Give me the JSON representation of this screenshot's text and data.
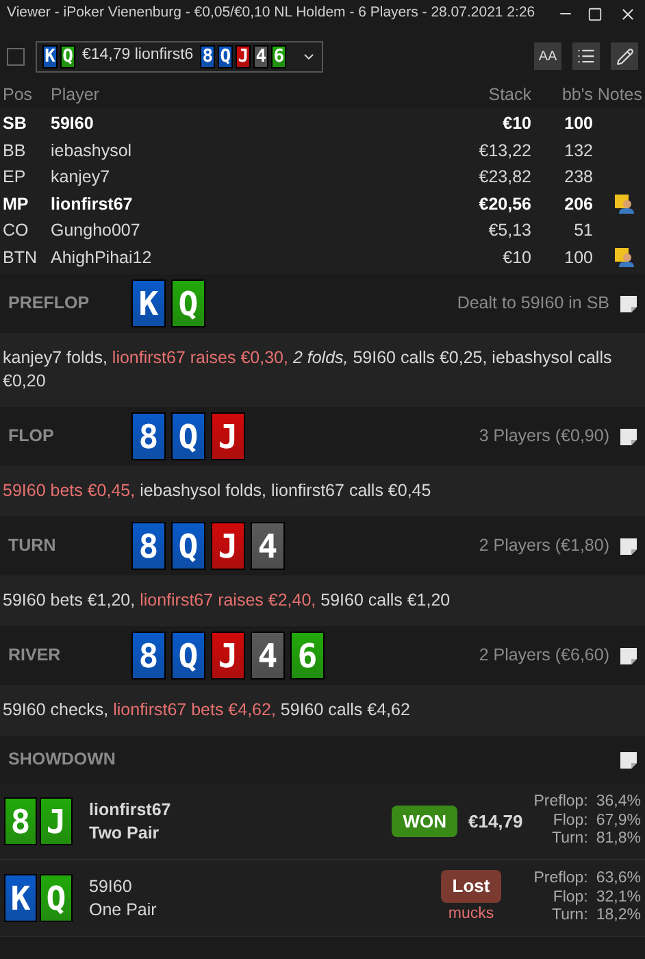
{
  "window": {
    "title": "Viewer - iPoker Vienenburg - €0,05/€0,10 NL Holdem - 6 Players - 28.07.2021 2:26"
  },
  "toolbar": {
    "checked": false,
    "hand_selector": {
      "hero_cards": [
        {
          "rank": "K",
          "color": "#0a5ac8"
        },
        {
          "rank": "Q",
          "color": "#22a80a"
        }
      ],
      "text": "€14,79 lionfirst6",
      "board": [
        {
          "rank": "8",
          "color": "#0a5ac8"
        },
        {
          "rank": "Q",
          "color": "#0a5ac8"
        },
        {
          "rank": "J",
          "color": "#d00a0a"
        },
        {
          "rank": "4",
          "color": "#5a5a5a"
        },
        {
          "rank": "6",
          "color": "#22a80a"
        }
      ]
    },
    "font_button": "AA"
  },
  "table": {
    "columns": [
      "Pos",
      "Player",
      "Stack",
      "bb's",
      "Notes"
    ],
    "rows": [
      {
        "pos": "SB",
        "player": "59I60",
        "stack": "€10",
        "bbs": "100",
        "bold": true,
        "note": false
      },
      {
        "pos": "BB",
        "player": "iebashysol",
        "stack": "€13,22",
        "bbs": "132",
        "bold": false,
        "note": false
      },
      {
        "pos": "EP",
        "player": "kanjey7",
        "stack": "€23,82",
        "bbs": "238",
        "bold": false,
        "note": false
      },
      {
        "pos": "MP",
        "player": "lionfirst67",
        "stack": "€20,56",
        "bbs": "206",
        "bold": true,
        "note": true
      },
      {
        "pos": "CO",
        "player": "Gungho007",
        "stack": "€5,13",
        "bbs": "51",
        "bold": false,
        "note": false
      },
      {
        "pos": "BTN",
        "player": "AhighPihai12",
        "stack": "€10",
        "bbs": "100",
        "bold": false,
        "note": true
      }
    ]
  },
  "streets": [
    {
      "name": "PREFLOP",
      "cards": [
        {
          "rank": "K",
          "color": "#0a5ac8"
        },
        {
          "rank": "Q",
          "color": "#22a80a"
        }
      ],
      "info": "Dealt to 59I60 in SB",
      "actions": [
        {
          "text": "kanjey7 folds, ",
          "kind": "normal"
        },
        {
          "text": "lionfirst67 raises €0,30,",
          "kind": "hero"
        },
        {
          "text": " 2 folds,",
          "kind": "summary"
        },
        {
          "text": " 59I60 calls €0,25, iebashysol calls €0,20",
          "kind": "normal"
        }
      ]
    },
    {
      "name": "FLOP",
      "cards": [
        {
          "rank": "8",
          "color": "#0a5ac8"
        },
        {
          "rank": "Q",
          "color": "#0a5ac8"
        },
        {
          "rank": "J",
          "color": "#d00a0a"
        }
      ],
      "info": "3 Players (€0,90)",
      "actions": [
        {
          "text": "59I60 bets €0,45,",
          "kind": "hero"
        },
        {
          "text": " iebashysol folds, lionfirst67 calls €0,45",
          "kind": "normal"
        }
      ]
    },
    {
      "name": "TURN",
      "cards": [
        {
          "rank": "8",
          "color": "#0a5ac8"
        },
        {
          "rank": "Q",
          "color": "#0a5ac8"
        },
        {
          "rank": "J",
          "color": "#d00a0a"
        },
        {
          "rank": "4",
          "color": "#5a5a5a"
        }
      ],
      "info": "2 Players (€1,80)",
      "actions": [
        {
          "text": "59I60 bets €1,20, ",
          "kind": "normal"
        },
        {
          "text": "lionfirst67 raises €2,40,",
          "kind": "hero"
        },
        {
          "text": " 59I60 calls €1,20",
          "kind": "normal"
        }
      ]
    },
    {
      "name": "RIVER",
      "cards": [
        {
          "rank": "8",
          "color": "#0a5ac8"
        },
        {
          "rank": "Q",
          "color": "#0a5ac8"
        },
        {
          "rank": "J",
          "color": "#d00a0a"
        },
        {
          "rank": "4",
          "color": "#5a5a5a"
        },
        {
          "rank": "6",
          "color": "#22a80a"
        }
      ],
      "info": "2 Players (€6,60)",
      "actions": [
        {
          "text": "59I60 checks, ",
          "kind": "normal"
        },
        {
          "text": "lionfirst67 bets €4,62,",
          "kind": "hero"
        },
        {
          "text": " 59I60 calls €4,62",
          "kind": "normal"
        }
      ]
    }
  ],
  "showdown": {
    "title": "SHOWDOWN",
    "players": [
      {
        "cards": [
          {
            "rank": "8",
            "color": "#22a80a"
          },
          {
            "rank": "J",
            "color": "#22a80a"
          }
        ],
        "name": "lionfirst67",
        "hand": "Two Pair",
        "bold": true,
        "kind": "won",
        "badge": "WON",
        "amount": "€14,79",
        "equity": [
          {
            "label": "Preflop:",
            "value": "36,4%"
          },
          {
            "label": "Flop:",
            "value": "67,9%"
          },
          {
            "label": "Turn:",
            "value": "81,8%"
          }
        ]
      },
      {
        "cards": [
          {
            "rank": "K",
            "color": "#0a5ac8"
          },
          {
            "rank": "Q",
            "color": "#22a80a"
          }
        ],
        "name": "59I60",
        "hand": "One Pair",
        "bold": false,
        "kind": "lost",
        "badge": "Lost",
        "note": "mucks",
        "equity": [
          {
            "label": "Preflop:",
            "value": "63,6%"
          },
          {
            "label": "Flop:",
            "value": "32,1%"
          },
          {
            "label": "Turn:",
            "value": "18,2%"
          }
        ]
      }
    ]
  }
}
